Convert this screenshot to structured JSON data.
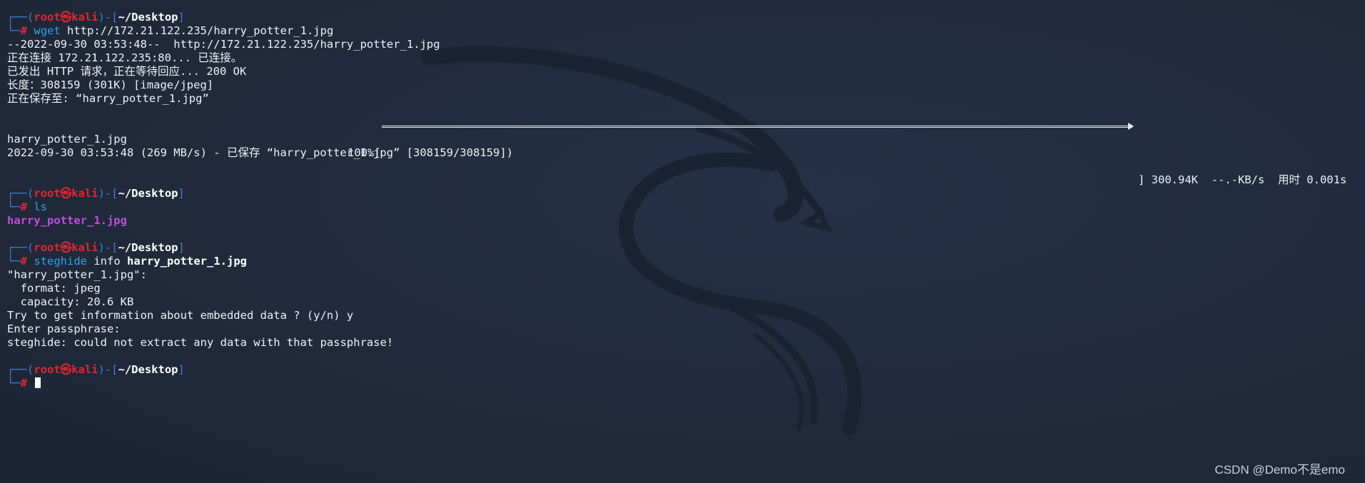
{
  "prompt": {
    "frame_top_open": "┌──(",
    "frame_mid": ")-[",
    "frame_close": "]",
    "frame_bottom": "└─",
    "user": "root",
    "at": "㉿",
    "host": "kali",
    "path": "~/Desktop",
    "symbol": "#"
  },
  "block1": {
    "cmd": "wget",
    "arg": " http://172.21.122.235/harry_potter_1.jpg",
    "out": [
      "--2022-09-30 03:53:48--  http://172.21.122.235/harry_potter_1.jpg",
      "正在连接 172.21.122.235:80... 已连接。",
      "已发出 HTTP 请求，正在等待回应... 200 OK",
      "长度：308159 (301K) [image/jpeg]",
      "正在保存至: “harry_potter_1.jpg”"
    ],
    "progress": {
      "file": "harry_potter_1.jpg",
      "percent_label": "100%[",
      "percent": 100,
      "tail": "] 300.94K  --.-KB/s  用时 0.001s"
    },
    "saved": "2022-09-30 03:53:48 (269 MB/s) - 已保存 “harry_potter_1.jpg” [308159/308159])"
  },
  "block2": {
    "cmd": "ls",
    "listing": "harry_potter_1.jpg"
  },
  "block3": {
    "cmd": "steghide",
    "arg_plain": " info ",
    "arg_bold": "harry_potter_1.jpg",
    "out": [
      "\"harry_potter_1.jpg\":",
      "  format: jpeg",
      "  capacity: 20.6 KB",
      "Try to get information about embedded data ? (y/n) y",
      "Enter passphrase:",
      "steghide: could not extract any data with that passphrase!"
    ]
  },
  "watermark": "CSDN @Demo不是emo",
  "colors": {
    "background": "#222a3b",
    "prompt_frame": "#3b7bd6",
    "prompt_user": "#e62530",
    "command": "#2aa4e6",
    "image_file": "#c14de0"
  }
}
